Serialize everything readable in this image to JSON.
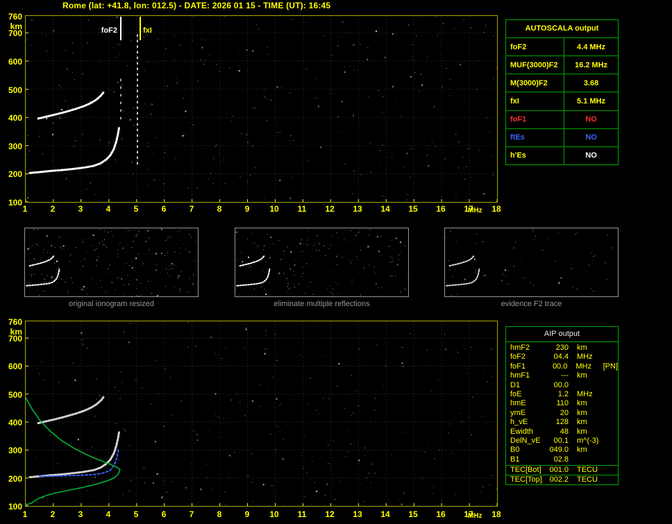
{
  "title": "Rome (lat: +41.8, lon: 012.5) - DATE: 2026 01 15 - TIME (UT): 16:45",
  "colors": {
    "axis": "#ffff00",
    "grid": "#303030",
    "table_green": "#00a400",
    "profile_green": "#00b43c",
    "restored_blue": "#3a5fff",
    "alert_red": "#ff2d2d",
    "caption_gray": "#989898"
  },
  "axes": {
    "x_ticks": [
      "1",
      "2",
      "3",
      "4",
      "5",
      "6",
      "7",
      "8",
      "9",
      "10",
      "11",
      "12",
      "13",
      "14",
      "15",
      "16",
      "17",
      "18"
    ],
    "x_unit": "MHz",
    "x_range": [
      1,
      18
    ],
    "y_ticks": [
      "760",
      "700",
      "600",
      "500",
      "400",
      "300",
      "200",
      "100"
    ],
    "y_unit": "km",
    "y_range": [
      100,
      760
    ]
  },
  "top_plot": {
    "fof2_label": "foF2",
    "fxi_label": "fxI",
    "fof2_mhz": 4.4,
    "fxi_mhz": 5.1,
    "noise": {
      "count": 330,
      "seed": 7
    },
    "traces": {
      "f2_trace": [
        [
          1.15,
          203
        ],
        [
          1.5,
          206
        ],
        [
          1.9,
          210
        ],
        [
          2.3,
          213
        ],
        [
          2.7,
          217
        ],
        [
          3.1,
          222
        ],
        [
          3.45,
          228
        ],
        [
          3.7,
          237
        ],
        [
          3.9,
          250
        ],
        [
          4.05,
          265
        ],
        [
          4.18,
          288
        ],
        [
          4.27,
          315
        ],
        [
          4.33,
          342
        ],
        [
          4.37,
          365
        ]
      ],
      "second_hop": [
        [
          1.45,
          396
        ],
        [
          1.75,
          403
        ],
        [
          2.1,
          411
        ],
        [
          2.45,
          420
        ],
        [
          2.8,
          430
        ],
        [
          3.1,
          440
        ],
        [
          3.35,
          451
        ],
        [
          3.55,
          463
        ],
        [
          3.72,
          478
        ],
        [
          3.83,
          492
        ]
      ],
      "x_mode_column": {
        "mhz": 5.03,
        "h": [
          235,
          705
        ]
      },
      "o_mode_column": {
        "mhz": 4.43,
        "h": [
          395,
          555
        ]
      }
    }
  },
  "bottom_plot": {
    "noise": {
      "count": 310,
      "seed": 13
    },
    "restored_trace": [
      [
        1.5,
        206
      ],
      [
        1.8,
        206
      ],
      [
        2.1,
        207
      ],
      [
        2.4,
        208
      ],
      [
        2.7,
        209
      ],
      [
        3.0,
        210
      ],
      [
        3.3,
        211
      ],
      [
        3.6,
        214
      ],
      [
        3.85,
        219
      ],
      [
        4.05,
        228
      ],
      [
        4.2,
        247
      ],
      [
        4.3,
        275
      ],
      [
        4.35,
        305
      ]
    ],
    "profile": {
      "topside": [
        [
          1.0,
          487
        ],
        [
          1.25,
          443
        ],
        [
          1.55,
          402
        ],
        [
          1.9,
          366
        ],
        [
          2.3,
          334
        ],
        [
          2.75,
          306
        ],
        [
          3.2,
          283
        ],
        [
          3.65,
          264
        ],
        [
          4.05,
          249
        ],
        [
          4.3,
          238
        ],
        [
          4.4,
          230
        ]
      ],
      "bottomside": [
        [
          4.4,
          230
        ],
        [
          4.35,
          216
        ],
        [
          4.22,
          202
        ],
        [
          3.95,
          190
        ],
        [
          3.55,
          178
        ],
        [
          3.05,
          166
        ],
        [
          2.55,
          156
        ],
        [
          2.05,
          146
        ],
        [
          1.7,
          136
        ],
        [
          1.45,
          126
        ],
        [
          1.3,
          117
        ],
        [
          1.22,
          111
        ]
      ],
      "e_region": [
        [
          1.0,
          101
        ],
        [
          1.08,
          106
        ],
        [
          1.18,
          110
        ],
        [
          1.22,
          111
        ]
      ]
    }
  },
  "autoscala": {
    "header": "AUTOSCALA output",
    "rows": [
      {
        "label": "foF2",
        "value": "4.4 MHz",
        "label_color": "#ffff00",
        "value_color": "#ffff00"
      },
      {
        "label": "MUF(3000)F2",
        "value": "16.2 MHz",
        "label_color": "#ffff00",
        "value_color": "#ffff00"
      },
      {
        "label": "M(3000)F2",
        "value": "3.68",
        "label_color": "#ffff00",
        "value_color": "#ffff00"
      },
      {
        "label": "fxI",
        "value": "5.1 MHz",
        "label_color": "#ffff00",
        "value_color": "#ffff00"
      },
      {
        "label": "foF1",
        "value": "NO",
        "label_color": "#ff2d2d",
        "value_color": "#ff2d2d"
      },
      {
        "label": "ftEs",
        "value": "NO",
        "label_color": "#3a66ff",
        "value_color": "#3a66ff"
      },
      {
        "label": "h'Es",
        "value": "NO",
        "label_color": "#ffff00",
        "value_color": "#ffffff"
      }
    ]
  },
  "thumbnails": [
    {
      "caption": "original ionogram resized",
      "noise_count": 230,
      "seed": 3,
      "trace_opacity": 1
    },
    {
      "caption": "eliminate multiple reflections",
      "noise_count": 170,
      "seed": 4,
      "trace_opacity": 1
    },
    {
      "caption": "evidence F2 trace",
      "noise_count": 70,
      "seed": 5,
      "trace_opacity": 0.85
    }
  ],
  "aip": {
    "header": "AIP output",
    "rows": [
      {
        "label": "hmF2",
        "value": "230",
        "unit": "km",
        "extra": ""
      },
      {
        "label": "foF2",
        "value": "04.4",
        "unit": "MHz",
        "extra": ""
      },
      {
        "label": "foF1",
        "value": "00.0",
        "unit": "MHz",
        "extra": "[PN]"
      },
      {
        "label": "hmF1",
        "value": "---",
        "unit": "km",
        "extra": ""
      },
      {
        "label": "D1",
        "value": "00.0",
        "unit": "",
        "extra": ""
      },
      {
        "label": "foE",
        "value": "1.2",
        "unit": "MHz",
        "extra": ""
      },
      {
        "label": "hmE",
        "value": "110",
        "unit": "km",
        "extra": ""
      },
      {
        "label": "ymE",
        "value": "20",
        "unit": "km",
        "extra": ""
      },
      {
        "label": "h_vE",
        "value": "128",
        "unit": "km",
        "extra": ""
      },
      {
        "label": "Ewidth",
        "value": "48",
        "unit": "km",
        "extra": ""
      },
      {
        "label": "DelN_vE",
        "value": "00.1",
        "unit": "m^(-3)",
        "extra": ""
      },
      {
        "label": "B0",
        "value": "049.0",
        "unit": "km",
        "extra": ""
      },
      {
        "label": "B1",
        "value": "02.8",
        "unit": "",
        "extra": ""
      }
    ],
    "tec_rows": [
      {
        "label": "TEC[Bot]",
        "value": "001.0",
        "unit": "TECU"
      },
      {
        "label": "TEC[Top]",
        "value": "002.2",
        "unit": "TECU"
      }
    ]
  }
}
